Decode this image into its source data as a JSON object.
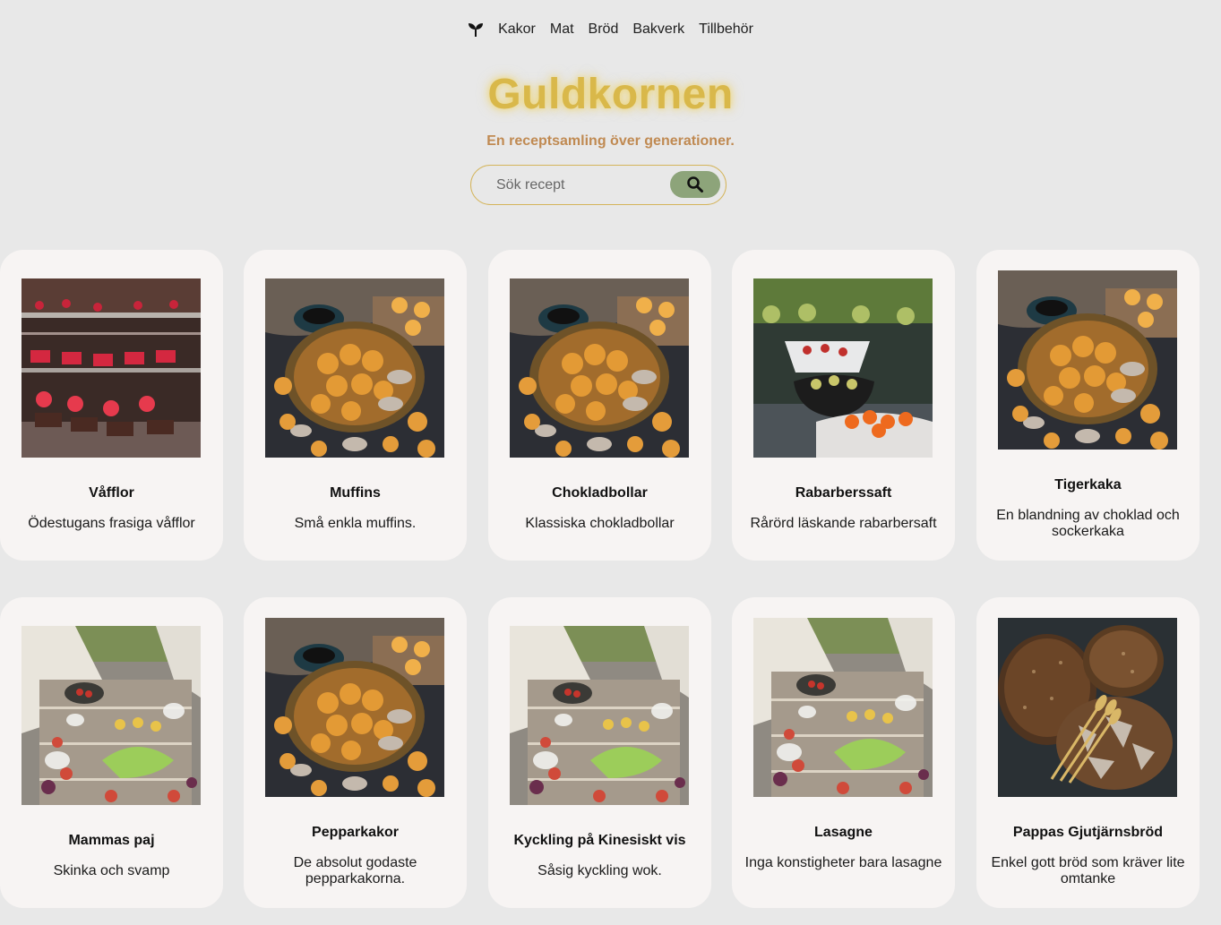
{
  "nav": {
    "logo_icon": "sprout-icon",
    "items": [
      "Kakor",
      "Mat",
      "Bröd",
      "Bakverk",
      "Tillbehör"
    ]
  },
  "header": {
    "title": "Guldkornen",
    "subtitle": "En receptsamling över generationer."
  },
  "search": {
    "placeholder": "Sök recept",
    "button_icon": "search-icon"
  },
  "colors": {
    "title": "#d9b84a",
    "subtitle": "#c08a52",
    "search_button": "#8da47a",
    "card_bg": "#f7f4f3",
    "page_bg": "#e8e8e8"
  },
  "recipes": [
    {
      "name": "Våfflor",
      "desc": "Ödestugans frasiga våfflor",
      "image": "bakery-display-photo"
    },
    {
      "name": "Muffins",
      "desc": "Små enkla muffins.",
      "image": "cookies-platter-photo"
    },
    {
      "name": "Chokladbollar",
      "desc": "Klassiska chokladbollar",
      "image": "cookies-platter-photo"
    },
    {
      "name": "Rabarberssaft",
      "desc": "Rårörd läskande rabarbersaft",
      "image": "salad-bowls-photo"
    },
    {
      "name": "Tigerkaka",
      "desc": "En blandning av choklad och sockerkaka",
      "image": "cookies-platter-photo"
    },
    {
      "name": "Mammas paj",
      "desc": "Skinka och svamp",
      "image": "picnic-table-photo"
    },
    {
      "name": "Pepparkakor",
      "desc": "De absolut godaste pepparkakorna.",
      "image": "cookies-platter-photo"
    },
    {
      "name": "Kyckling på Kinesiskt vis",
      "desc": "Såsig kyckling wok.",
      "image": "picnic-table-photo"
    },
    {
      "name": "Lasagne",
      "desc": "Inga konstigheter bara lasagne",
      "image": "picnic-table-photo"
    },
    {
      "name": "Pappas Gjutjärnsbröd",
      "desc": "Enkel gott bröd som kräver lite omtanke",
      "image": "bread-loaves-photo"
    }
  ]
}
